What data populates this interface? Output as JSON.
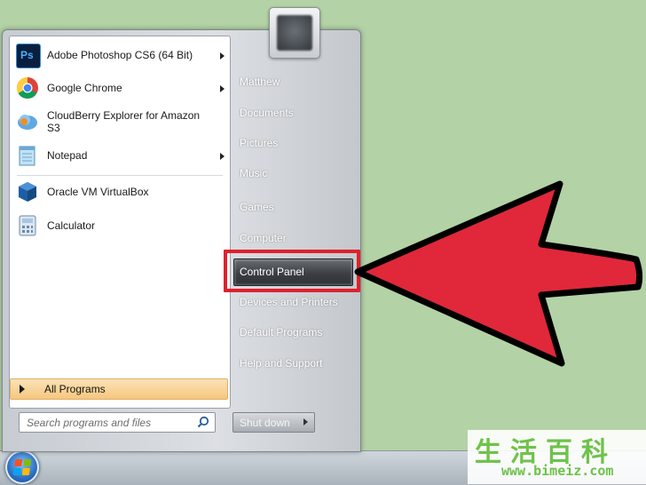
{
  "programs": [
    {
      "label": "Adobe Photoshop CS6 (64 Bit)",
      "icon": "photoshop-icon",
      "icon_text": "Ps",
      "has_submenu": true
    },
    {
      "label": "Google Chrome",
      "icon": "chrome-icon",
      "has_submenu": true
    },
    {
      "label": "CloudBerry Explorer for Amazon S3",
      "icon": "cloudberry-icon",
      "has_submenu": false
    },
    {
      "label": "Notepad",
      "icon": "notepad-icon",
      "has_submenu": true
    },
    {
      "label": "Oracle VM VirtualBox",
      "icon": "virtualbox-icon",
      "has_submenu": false
    },
    {
      "label": "Calculator",
      "icon": "calculator-icon",
      "has_submenu": false
    }
  ],
  "all_programs_label": "All Programs",
  "search": {
    "placeholder": "Search programs and files"
  },
  "right_items": [
    "Matthew",
    "Documents",
    "Pictures",
    "Music",
    "Games",
    "Computer",
    "Control Panel",
    "Devices and Printers",
    "Default Programs",
    "Help and Support"
  ],
  "highlighted_item": "Control Panel",
  "shutdown_label": "Shut down",
  "colors": {
    "highlight": "#e0202d",
    "arrow": "#e0283a",
    "background": "#b3d2a5"
  },
  "watermark": {
    "chars": "生活百科",
    "url": "www.bimeiz.com"
  }
}
